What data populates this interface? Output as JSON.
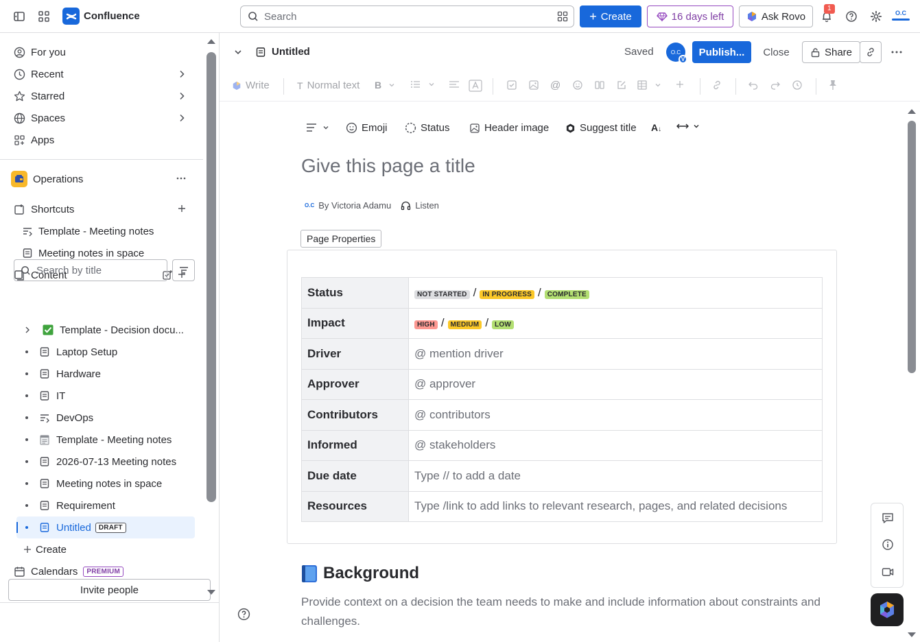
{
  "topbar": {
    "app_name": "Confluence",
    "search_placeholder": "Search",
    "create_label": "Create",
    "trial_label": "16 days left",
    "rovo_label": "Ask Rovo",
    "notifications_count": "1",
    "profile_initials": "O.C"
  },
  "sidebar": {
    "nav": [
      {
        "label": "For you"
      },
      {
        "label": "Recent"
      },
      {
        "label": "Starred"
      },
      {
        "label": "Spaces"
      },
      {
        "label": "Apps"
      }
    ],
    "space_name": "Operations",
    "shortcuts_label": "Shortcuts",
    "shortcuts": [
      {
        "label": "Template - Meeting notes"
      },
      {
        "label": "Meeting notes in space"
      }
    ],
    "content_label": "Content",
    "search_placeholder": "Search by title",
    "tree": [
      {
        "label": "Template - Decision docu...",
        "icon": "check-emoji-icon"
      },
      {
        "label": "Laptop Setup",
        "icon": "page-icon"
      },
      {
        "label": "Hardware",
        "icon": "page-icon"
      },
      {
        "label": "IT",
        "icon": "page-icon"
      },
      {
        "label": "DevOps",
        "icon": "live-doc-icon"
      },
      {
        "label": "Template - Meeting notes",
        "icon": "notepad-emoji-icon"
      },
      {
        "label": "2026-07-13 Meeting notes",
        "icon": "page-icon"
      },
      {
        "label": "Meeting notes in space",
        "icon": "page-icon"
      },
      {
        "label": "Requirement",
        "icon": "page-icon"
      },
      {
        "label": "Untitled",
        "icon": "page-icon",
        "badge": "DRAFT",
        "selected": true
      }
    ],
    "create_label": "Create",
    "calendars_label": "Calendars",
    "premium_badge": "PREMIUM",
    "invite_label": "Invite people"
  },
  "pageheader": {
    "title": "Untitled",
    "saved_label": "Saved",
    "avatar_initials": "O.C",
    "avatar_badge": "V",
    "publish_label": "Publish...",
    "close_label": "Close",
    "share_label": "Share"
  },
  "toolbar": {
    "write_label": "Write",
    "text_style_label": "Normal text"
  },
  "editor": {
    "meta_buttons": {
      "emoji": "Emoji",
      "status": "Status",
      "header_image": "Header image",
      "suggest_title": "Suggest title"
    },
    "title_placeholder": "Give this page a title",
    "byline": "By Victoria Adamu",
    "byline_avatar": "O.C",
    "listen_label": "Listen",
    "page_properties_label": "Page Properties",
    "properties": {
      "status_label": "Status",
      "status_values": [
        "NOT STARTED",
        "IN PROGRESS",
        "COMPLETE"
      ],
      "impact_label": "Impact",
      "impact_values": [
        "HIGH",
        "MEDIUM",
        "LOW"
      ],
      "driver_label": "Driver",
      "driver_value": "@ mention driver",
      "approver_label": "Approver",
      "approver_value": "@ approver",
      "contributors_label": "Contributors",
      "contributors_value": "@ contributors",
      "informed_label": "Informed",
      "informed_value": "@ stakeholders",
      "due_label": "Due date",
      "due_value": "Type // to add a date",
      "resources_label": "Resources",
      "resources_value": "Type /link to add links to relevant research, pages, and related decisions"
    },
    "background_heading": "Background",
    "background_text": "Provide context on a decision the team needs to make and include information about constraints and challenges."
  },
  "colors": {
    "brand_blue": "#1868db",
    "trial_purple": "#803fa5",
    "lozenge_grey": "#dddee1",
    "lozenge_yellow": "#fbc828",
    "lozenge_green": "#b3df72",
    "lozenge_red": "#fd9891"
  }
}
